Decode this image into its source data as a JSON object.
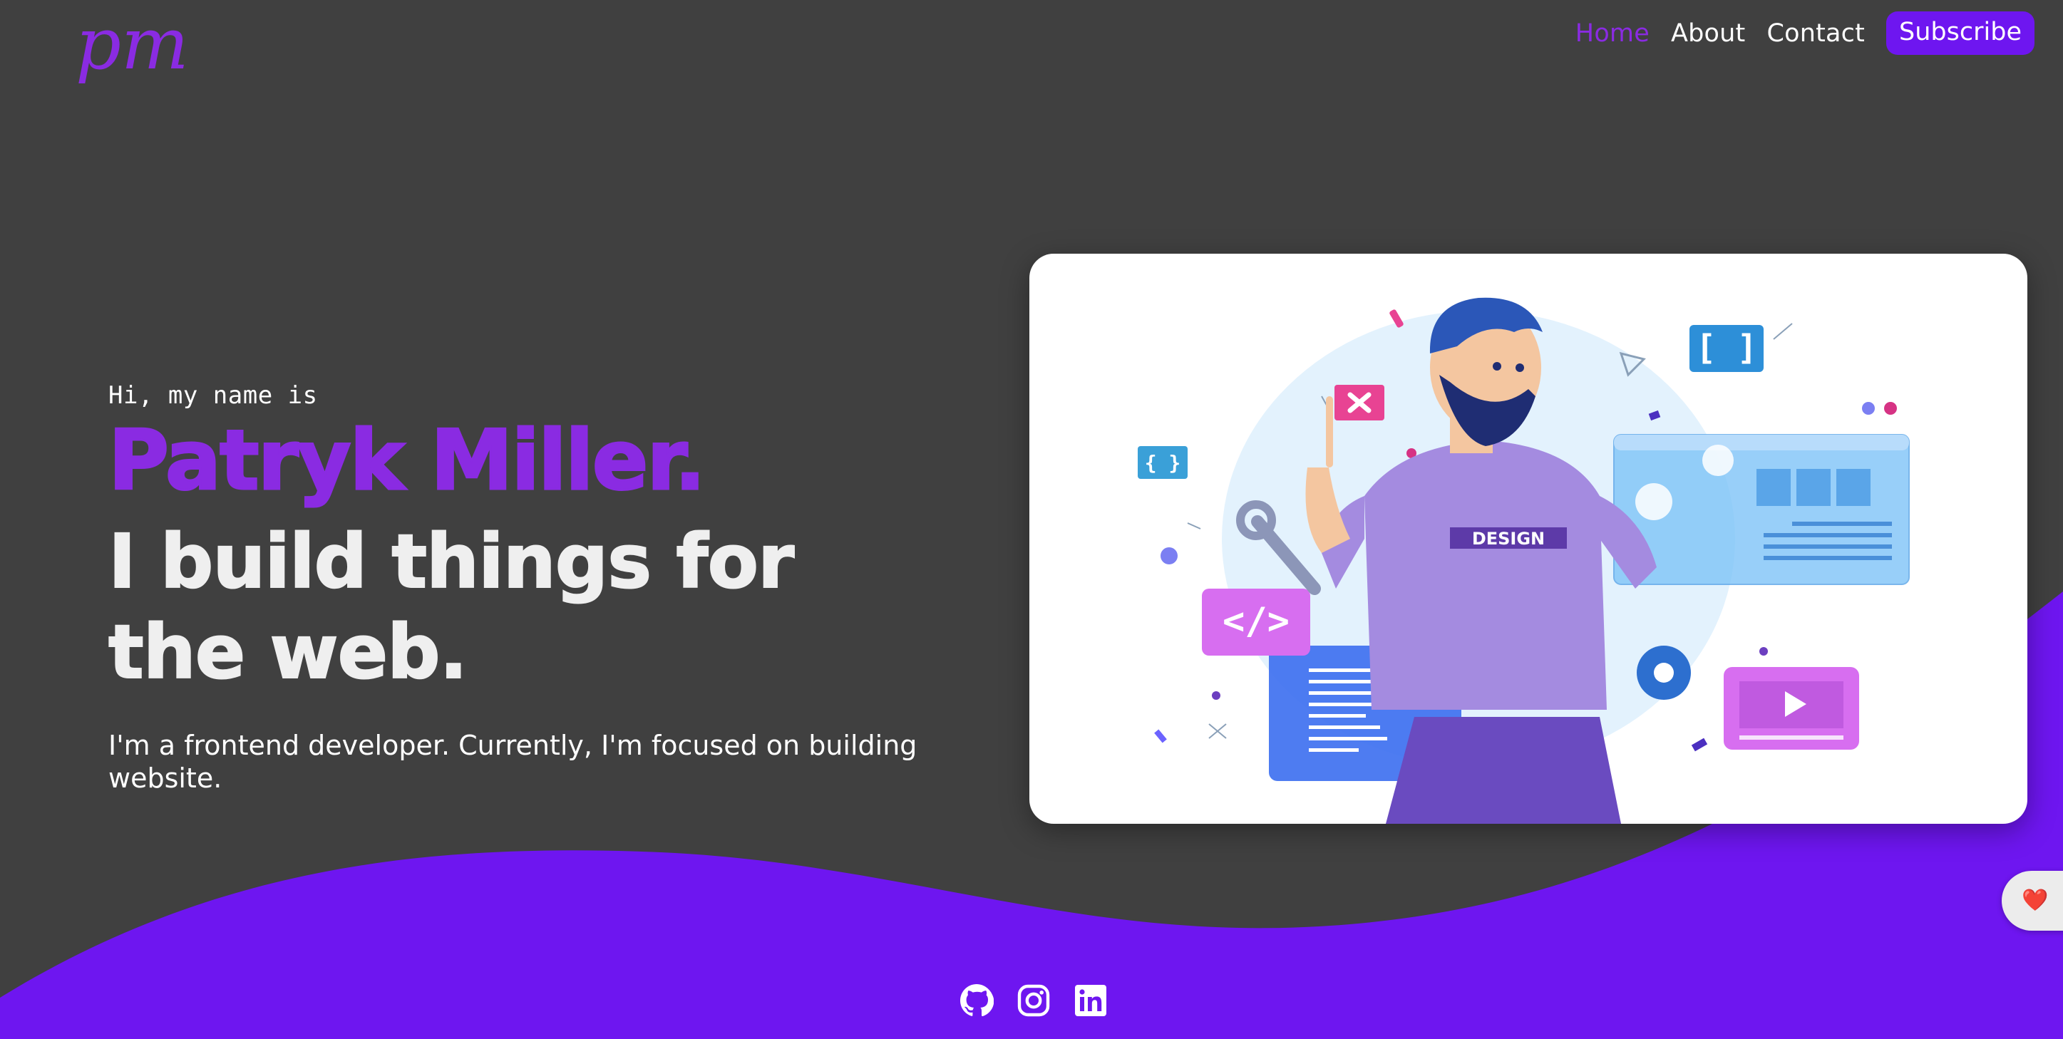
{
  "header": {
    "logo_text": "pm",
    "nav": [
      {
        "label": "Home",
        "active": true
      },
      {
        "label": "About",
        "active": false
      },
      {
        "label": "Contact",
        "active": false
      }
    ],
    "subscribe_label": "Subscribe"
  },
  "hero": {
    "greeting": "Hi, my name is",
    "name": "Patryk Miller.",
    "tagline": "I build things for the web.",
    "bio": "I'm a frontend developer. Currently, I'm focused on building website.",
    "illustration": {
      "shirt_text": "DESIGN",
      "code_tag": "</>",
      "bracket_tags": [
        "[ ]",
        "{ }"
      ]
    }
  },
  "socials": [
    {
      "icon": "github-icon"
    },
    {
      "icon": "instagram-icon"
    },
    {
      "icon": "linkedin-icon"
    }
  ],
  "like_button": {
    "icon": "heart-icon",
    "emoji": "❤️"
  },
  "colors": {
    "background": "#404040",
    "accent": "#8a2be2",
    "wave": "#6e16f0",
    "text": "#ffffff"
  }
}
